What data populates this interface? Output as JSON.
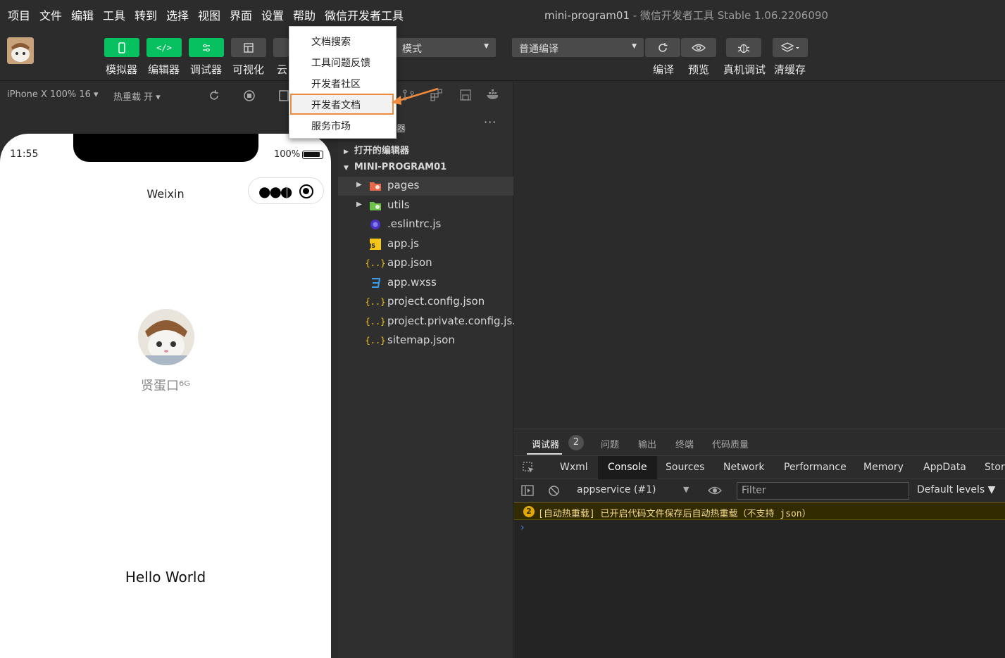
{
  "menubar": {
    "items": [
      "项目",
      "文件",
      "编辑",
      "工具",
      "转到",
      "选择",
      "视图",
      "界面",
      "设置",
      "帮助",
      "微信开发者工具"
    ],
    "window_title_project": "mini-program01",
    "window_title_rest": " - 微信开发者工具 Stable 1.06.2206090"
  },
  "toolbar": {
    "simulator": "模拟器",
    "editor": "编辑器",
    "debugger": "调试器",
    "visual": "可视化",
    "cloud": "云",
    "mode_select": "模式",
    "compile_select": "普通编译",
    "compile": "编译",
    "preview": "预览",
    "real_debug": "真机调试",
    "clear_cache": "清缓存"
  },
  "simbar": {
    "device": "iPhone X 100% 16",
    "hot_reload": "热重载 开"
  },
  "phone": {
    "time": "11:55",
    "battery": "100%",
    "nav_title": "Weixin",
    "nickname": "贤蛋口⁶ᴳ",
    "hello": "Hello World"
  },
  "dropdown": {
    "items": [
      "文档搜索",
      "工具问题反馈",
      "开发者社区",
      "开发者文档",
      "服务市场"
    ]
  },
  "explorer": {
    "header": "器",
    "open_editors": "打开的编辑器",
    "project": "MINI-PROGRAM01",
    "files": [
      {
        "name": "pages",
        "type": "folder"
      },
      {
        "name": "utils",
        "type": "folder"
      },
      {
        "name": ".eslintrc.js",
        "type": "eslint"
      },
      {
        "name": "app.js",
        "type": "js"
      },
      {
        "name": "app.json",
        "type": "json"
      },
      {
        "name": "app.wxss",
        "type": "css"
      },
      {
        "name": "project.config.json",
        "type": "json"
      },
      {
        "name": "project.private.config.js...",
        "type": "json"
      },
      {
        "name": "sitemap.json",
        "type": "json"
      }
    ]
  },
  "debug": {
    "tabs": [
      "调试器",
      "问题",
      "输出",
      "终端",
      "代码质量"
    ],
    "badge": "2",
    "devtools_tabs": [
      "Wxml",
      "Console",
      "Sources",
      "Network",
      "Performance",
      "Memory",
      "AppData",
      "Stora"
    ],
    "context": "appservice (#1)",
    "filter_placeholder": "Filter",
    "levels": "Default levels",
    "warn_count": "2",
    "warn_text": "[自动热重载] 已开启代码文件保存后自动热重载（不支持 json）",
    "prompt": "›"
  },
  "colors": {
    "accent_green": "#07c160",
    "highlight_orange": "#f08a3c"
  }
}
